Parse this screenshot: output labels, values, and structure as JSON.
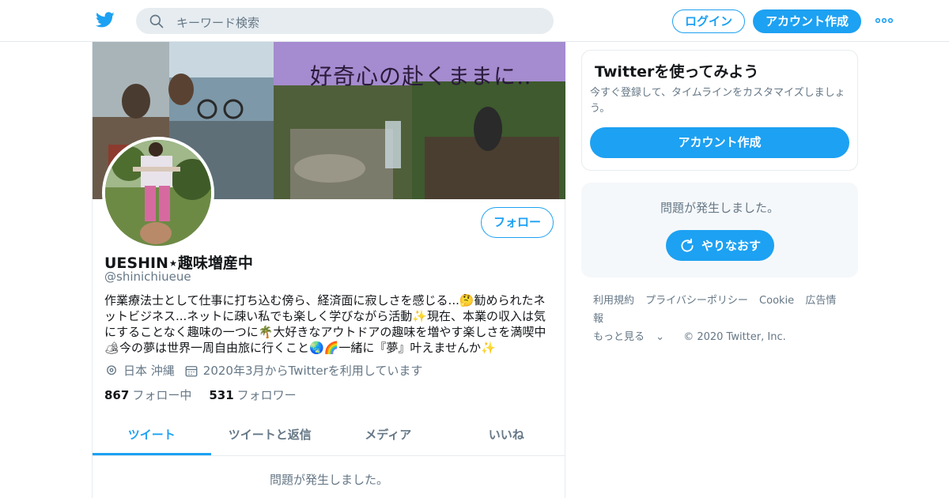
{
  "topbar": {
    "logo_icon": "twitter-bird-icon",
    "search_placeholder": "キーワード検索",
    "login_label": "ログイン",
    "signup_label": "アカウント作成",
    "more_icon": "more-dots-icon"
  },
  "colors": {
    "accent": "#1da1f2",
    "muted_text": "#657786",
    "primary_text": "#14171a"
  },
  "profile": {
    "banner_text": "好奇心の赴くままに‥",
    "follow_label": "フォロー",
    "name": "UESHIN⋆趣味増産中",
    "handle": "@shinichiueue",
    "bio": "作業療法士として仕事に打ち込む傍ら、経済面に寂しさを感じる...🤔勧められたネットビジネス...ネットに疎い私でも楽しく学びながら活動✨現在、本業の収入は気にすることなく趣味の一つに🌴大好きなアウトドアの趣味を増やす楽しさを満喫中🏕今の夢は世界一周自由旅に行くこと🌏🌈一緒に『夢』叶えませんか✨",
    "location": "日本 沖縄",
    "joined": "2020年3月からTwitterを利用しています",
    "following_count": "867",
    "following_label": "フォロー中",
    "followers_count": "531",
    "followers_label": "フォロワー"
  },
  "tabs": [
    {
      "label": "ツイート",
      "active": true
    },
    {
      "label": "ツイートと返信",
      "active": false
    },
    {
      "label": "メディア",
      "active": false
    },
    {
      "label": "いいね",
      "active": false
    }
  ],
  "timeline_error": "問題が発生しました。",
  "sidebar": {
    "signup_card": {
      "title": "Twitterを使ってみよう",
      "description": "今すぐ登録して、タイムラインをカスタマイズしましょう。",
      "button": "アカウント作成"
    },
    "error_card": {
      "message": "問題が発生しました。",
      "retry": "やりなおす"
    },
    "footer": {
      "links": [
        "利用規約",
        "プライバシーポリシー",
        "Cookie",
        "広告情報"
      ],
      "more": "もっと見る",
      "copyright": "© 2020 Twitter, Inc."
    }
  }
}
